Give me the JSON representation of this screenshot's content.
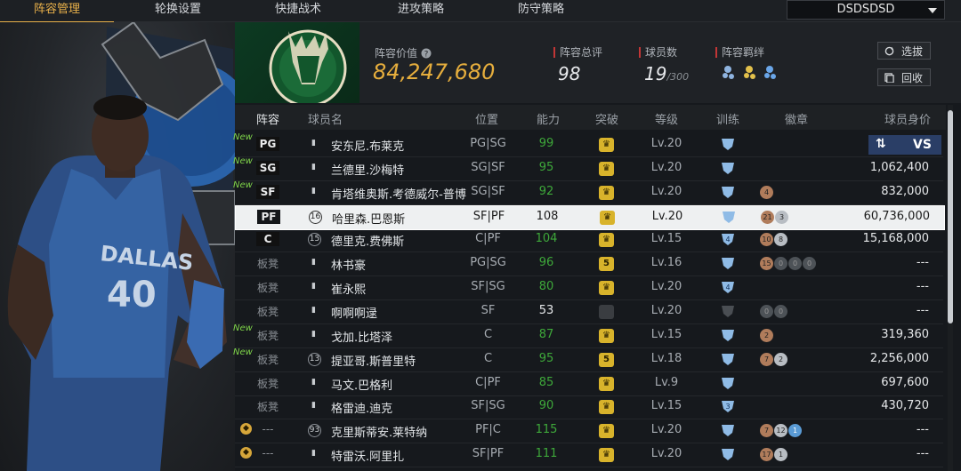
{
  "tabs": [
    "阵容管理",
    "轮换设置",
    "快捷战术",
    "进攻策略",
    "防守策略"
  ],
  "team_select": "DSDSDSD",
  "summary": {
    "lineup_value_label": "阵容价值",
    "lineup_value": "84,247,680",
    "rating_label": "阵容总评",
    "rating": "98",
    "players_label": "球员数",
    "players_count": "19",
    "players_max": "/300",
    "bond_label": "阵容羁绊",
    "select_btn": "选拔",
    "recycle_btn": "回收"
  },
  "hero": {
    "jersey_team": "DALLAS",
    "jersey_number": "40"
  },
  "columns": [
    "阵容",
    "球员名",
    "位置",
    "能力",
    "突破",
    "等级",
    "训练",
    "徽章",
    "球员身价"
  ],
  "compare_label": "VS",
  "rows": [
    {
      "new": "New",
      "slot": "PG",
      "num": "",
      "name": "安东尼.布莱克",
      "pos": "PG|SG",
      "ovr": "99",
      "brk": "",
      "lvl": "Lv.20",
      "train": "",
      "badges": [],
      "val": ""
    },
    {
      "new": "New",
      "slot": "SG",
      "num": "",
      "name": "兰德里.沙梅特",
      "pos": "SG|SF",
      "ovr": "95",
      "brk": "",
      "lvl": "Lv.20",
      "train": "",
      "badges": [],
      "val": "1,062,400"
    },
    {
      "new": "New",
      "slot": "SF",
      "num": "",
      "name": "肯塔维奥斯.考德威尔-普博",
      "pos": "SG|SF",
      "ovr": "92",
      "brk": "",
      "lvl": "Lv.20",
      "train": "",
      "badges": [
        {
          "c": "bronze",
          "t": "4"
        }
      ],
      "val": "832,000"
    },
    {
      "new": "",
      "slot": "PF",
      "num": "16",
      "name": "哈里森.巴恩斯",
      "pos": "SF|PF",
      "ovr": "108",
      "brk": "",
      "lvl": "Lv.20",
      "train": "",
      "badges": [
        {
          "c": "bronze",
          "t": "21"
        },
        {
          "c": "silver",
          "t": "3"
        }
      ],
      "val": "60,736,000"
    },
    {
      "new": "",
      "slot": "C",
      "num": "15",
      "name": "德里克.费佛斯",
      "pos": "C|PF",
      "ovr": "104",
      "brk": "",
      "lvl": "Lv.15",
      "train": "4",
      "badges": [
        {
          "c": "bronze",
          "t": "10"
        },
        {
          "c": "silver",
          "t": "8"
        }
      ],
      "val": "15,168,000"
    },
    {
      "new": "",
      "slot": "板凳",
      "num": "",
      "name": "林书豪",
      "pos": "PG|SG",
      "ovr": "96",
      "brk": "5",
      "lvl": "Lv.16",
      "train": "",
      "badges": [
        {
          "c": "bronze",
          "t": "15"
        },
        {
          "c": "gray",
          "t": "0"
        },
        {
          "c": "gray",
          "t": "0"
        },
        {
          "c": "gray",
          "t": "0"
        }
      ],
      "val": "---"
    },
    {
      "new": "",
      "slot": "板凳",
      "num": "",
      "name": "崔永熙",
      "pos": "SF|SG",
      "ovr": "80",
      "brk": "",
      "lvl": "Lv.20",
      "train": "4",
      "badges": [],
      "val": "---"
    },
    {
      "new": "",
      "slot": "板凳",
      "num": "",
      "name": "啊啊啊逯",
      "pos": "SF",
      "ovr": "53",
      "brk": "none",
      "lvl": "Lv.20",
      "train": "",
      "badges": [
        {
          "c": "gray",
          "t": "0"
        },
        {
          "c": "gray",
          "t": "0"
        }
      ],
      "val": "---"
    },
    {
      "new": "New",
      "slot": "板凳",
      "num": "",
      "name": "戈加.比塔泽",
      "pos": "C",
      "ovr": "87",
      "brk": "",
      "lvl": "Lv.15",
      "train": "",
      "badges": [
        {
          "c": "bronze",
          "t": "2"
        }
      ],
      "val": "319,360"
    },
    {
      "new": "New",
      "slot": "板凳",
      "num": "13",
      "name": "提亚哥.斯普里特",
      "pos": "C",
      "ovr": "95",
      "brk": "5",
      "lvl": "Lv.18",
      "train": "",
      "badges": [
        {
          "c": "bronze",
          "t": "7"
        },
        {
          "c": "silver",
          "t": "2"
        }
      ],
      "val": "2,256,000"
    },
    {
      "new": "",
      "slot": "板凳",
      "num": "",
      "name": "马文.巴格利",
      "pos": "C|PF",
      "ovr": "85",
      "brk": "",
      "lvl": "Lv.9",
      "train": "",
      "badges": [],
      "val": "697,600"
    },
    {
      "new": "",
      "slot": "板凳",
      "num": "",
      "name": "格雷迪.迪克",
      "pos": "SF|SG",
      "ovr": "90",
      "brk": "",
      "lvl": "Lv.15",
      "train": "3",
      "badges": [],
      "val": "430,720"
    },
    {
      "new": "",
      "slot": "---",
      "num": "93",
      "name": "克里斯蒂安.莱特纳",
      "pos": "PF|C",
      "ovr": "115",
      "brk": "",
      "lvl": "Lv.20",
      "train": "",
      "badges": [
        {
          "c": "bronze",
          "t": "7"
        },
        {
          "c": "silver",
          "t": "12"
        },
        {
          "c": "blue",
          "t": "1"
        }
      ],
      "val": "---"
    },
    {
      "new": "",
      "slot": "---",
      "num": "",
      "name": "特雷沃.阿里扎",
      "pos": "SF|PF",
      "ovr": "111",
      "brk": "",
      "lvl": "Lv.20",
      "train": "",
      "badges": [
        {
          "c": "bronze",
          "t": "17"
        },
        {
          "c": "silver",
          "t": "1"
        }
      ],
      "val": "---"
    }
  ]
}
